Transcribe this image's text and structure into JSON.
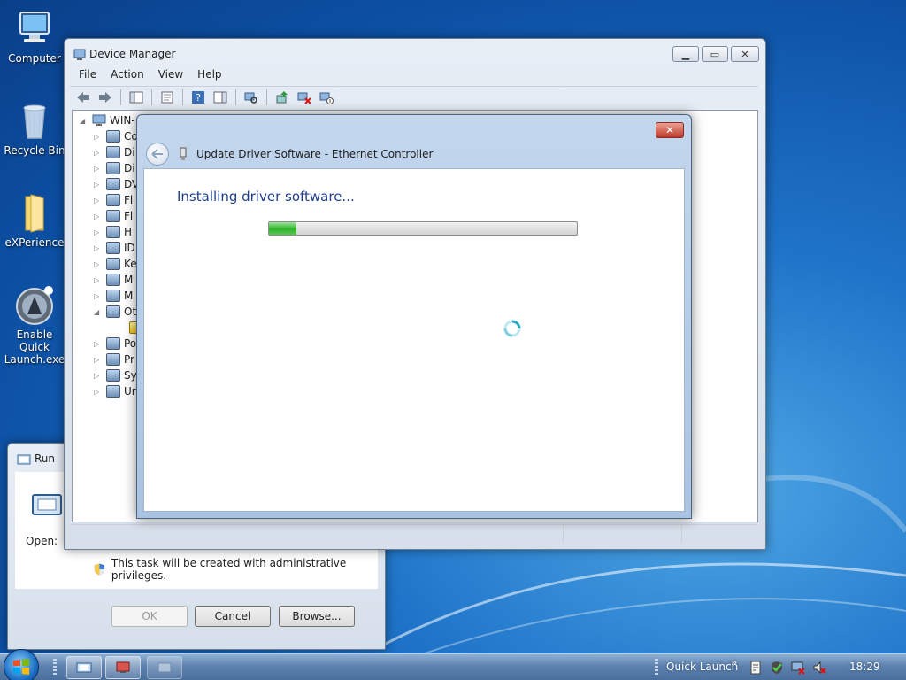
{
  "desktop": {
    "icons": [
      {
        "label": "Computer",
        "icon": "computer-icon"
      },
      {
        "label": "Recycle Bin",
        "icon": "recycle-bin-icon"
      },
      {
        "label": "eXPerience",
        "icon": "folder-icon"
      },
      {
        "label": "Enable Quick\nLaunch.exe",
        "icon": "app-icon"
      }
    ]
  },
  "device_manager": {
    "title": "Device Manager",
    "menu": [
      "File",
      "Action",
      "View",
      "Help"
    ],
    "root_label": "WIN-",
    "tree_rows": [
      "Co",
      "Di",
      "Di",
      "DV",
      "Fl",
      "Fl",
      "H",
      "ID",
      "Ke",
      "M",
      "M",
      "Ot",
      "",
      "Po",
      "Pr",
      "Sy",
      "Ur"
    ]
  },
  "update_driver": {
    "title": "Update Driver Software - Ethernet Controller",
    "heading": "Installing driver software...",
    "progress": 0.09,
    "close_symbol": "✕"
  },
  "run_dialog": {
    "title": "Run",
    "open_label": "Open:",
    "admin_note": "This task will be created with administrative privileges.",
    "ok_label": "OK",
    "cancel_label": "Cancel",
    "browse_label": "Browse..."
  },
  "taskbar": {
    "quick_launch_label": "Quick Launch",
    "chevron": "»",
    "clock": "18:29"
  },
  "colors": {
    "desktop_blue": "#1f74c9",
    "heading_blue": "#1e3f8c",
    "progress_green": "#2fb52c",
    "close_red": "#c0392b"
  }
}
